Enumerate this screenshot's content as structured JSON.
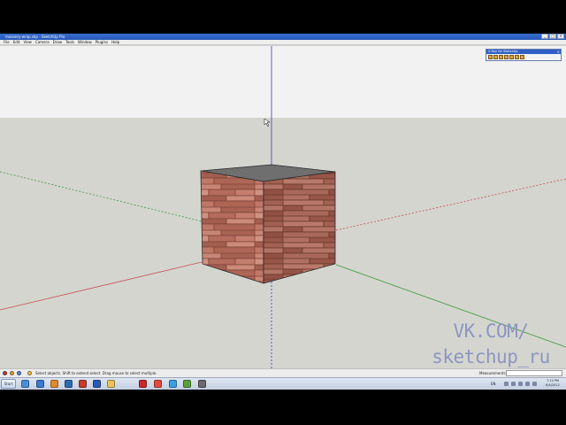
{
  "window": {
    "title": "masonry-wrap.skp - SketchUp Pro",
    "controls": [
      "_",
      "□",
      "×"
    ]
  },
  "menu": {
    "items": [
      "File",
      "Edit",
      "View",
      "Camera",
      "Draw",
      "Tools",
      "Window",
      "Plugins",
      "Help"
    ]
  },
  "palette": {
    "title": "V-Ray for SketchUp",
    "close": "×"
  },
  "statusbar": {
    "help_text": "Select objects. Shift to extend select. Drag mouse to select multiple.",
    "measurements_label": "Measurements",
    "measurements_value": ""
  },
  "taskbar": {
    "start_label": "Start",
    "language": "EN",
    "time": "7:10 PM",
    "date": "6/4/2012"
  },
  "watermark": {
    "line1": "VK.COM/",
    "line2": "sketchup_ru"
  },
  "colors": {
    "sky": "#f2f2f2",
    "ground": "#d5d5d0",
    "brick": "#b87060",
    "red_axis": "#c45050",
    "green_axis": "#3a9a3a",
    "blue_axis": "#3a3ab8"
  },
  "icons": {
    "taskbar_apps": [
      "explorer-icon",
      "ie-icon",
      "firefox-icon",
      "media-icon",
      "sketchup-icon",
      "word-icon",
      "folder-icon",
      "filezilla-icon",
      "chrome-icon",
      "skype-icon",
      "torrent-icon",
      "app-icon"
    ]
  }
}
